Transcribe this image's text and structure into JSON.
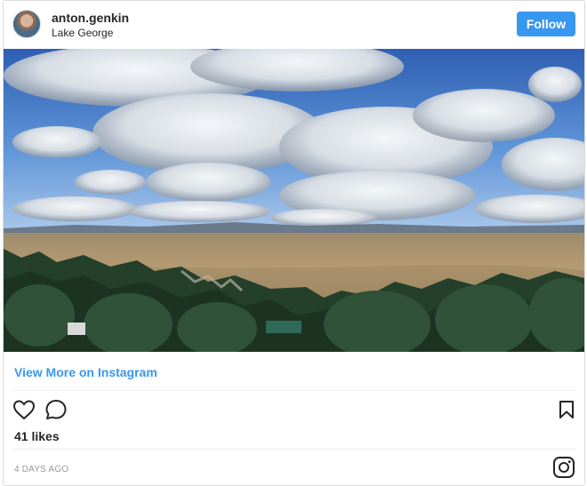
{
  "header": {
    "username": "anton.genkin",
    "location": "Lake George",
    "follow_label": "Follow"
  },
  "post": {
    "view_more_label": "View More on Instagram",
    "likes": "41 likes",
    "timestamp": "4 DAYS AGO"
  },
  "icons": {
    "heart": "heart-icon",
    "comment": "comment-icon",
    "bookmark": "bookmark-icon",
    "instagram": "instagram-icon"
  },
  "colors": {
    "accent": "#3897f0",
    "text": "#262626",
    "muted": "#999999",
    "border": "#dbdbdb"
  }
}
